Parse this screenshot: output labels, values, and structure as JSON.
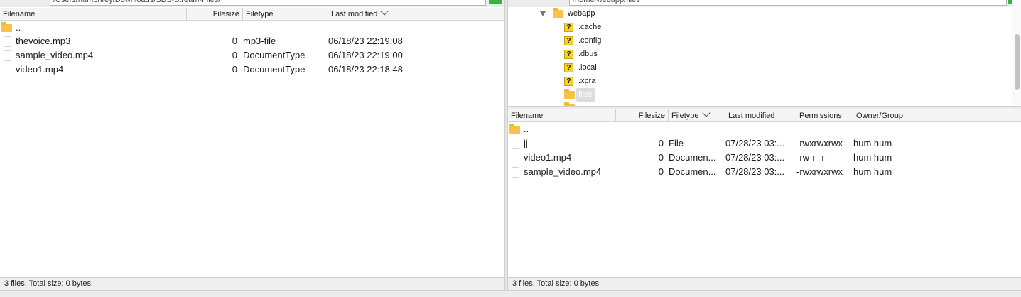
{
  "local": {
    "path": "/Users/humphrey/Downloads/SBS-Stream-Files/",
    "columns": [
      "Filename",
      "Filesize",
      "Filetype",
      "Last modified"
    ],
    "parent_label": "..",
    "files": [
      {
        "name": "thevoice.mp3",
        "size": "0",
        "type": "mp3-file",
        "modified": "06/18/23 22:19:08"
      },
      {
        "name": "sample_video.mp4",
        "size": "0",
        "type": "DocumentType",
        "modified": "06/18/23 22:19:00"
      },
      {
        "name": "video1.mp4",
        "size": "0",
        "type": "DocumentType",
        "modified": "06/18/23 22:18:48"
      }
    ],
    "status": "3 files. Total size: 0 bytes"
  },
  "remote": {
    "path": "/home/webapp/files",
    "tree": {
      "root": "webapp",
      "children": [
        ".cache",
        ".config",
        ".dbus",
        ".local",
        ".xpra"
      ],
      "selected": "files"
    },
    "columns": [
      "Filename",
      "Filesize",
      "Filetype",
      "Last modified",
      "Permissions",
      "Owner/Group"
    ],
    "parent_label": "..",
    "files": [
      {
        "name": "jj",
        "size": "0",
        "type": "File",
        "modified": "07/28/23 03:...",
        "perms": "-rwxrwxrwx",
        "owner": "hum hum"
      },
      {
        "name": "video1.mp4",
        "size": "0",
        "type": "Documen...",
        "modified": "07/28/23 03:...",
        "perms": "-rw-r--r--",
        "owner": "hum hum"
      },
      {
        "name": "sample_video.mp4",
        "size": "0",
        "type": "Documen...",
        "modified": "07/28/23 03:...",
        "perms": "-rwxrwxrwx",
        "owner": "hum hum"
      }
    ],
    "status": "3 files. Total size: 0 bytes"
  },
  "colors": {
    "accent": "#3cb043",
    "folder": "#f6c343",
    "unknown": "#f5d02b"
  }
}
